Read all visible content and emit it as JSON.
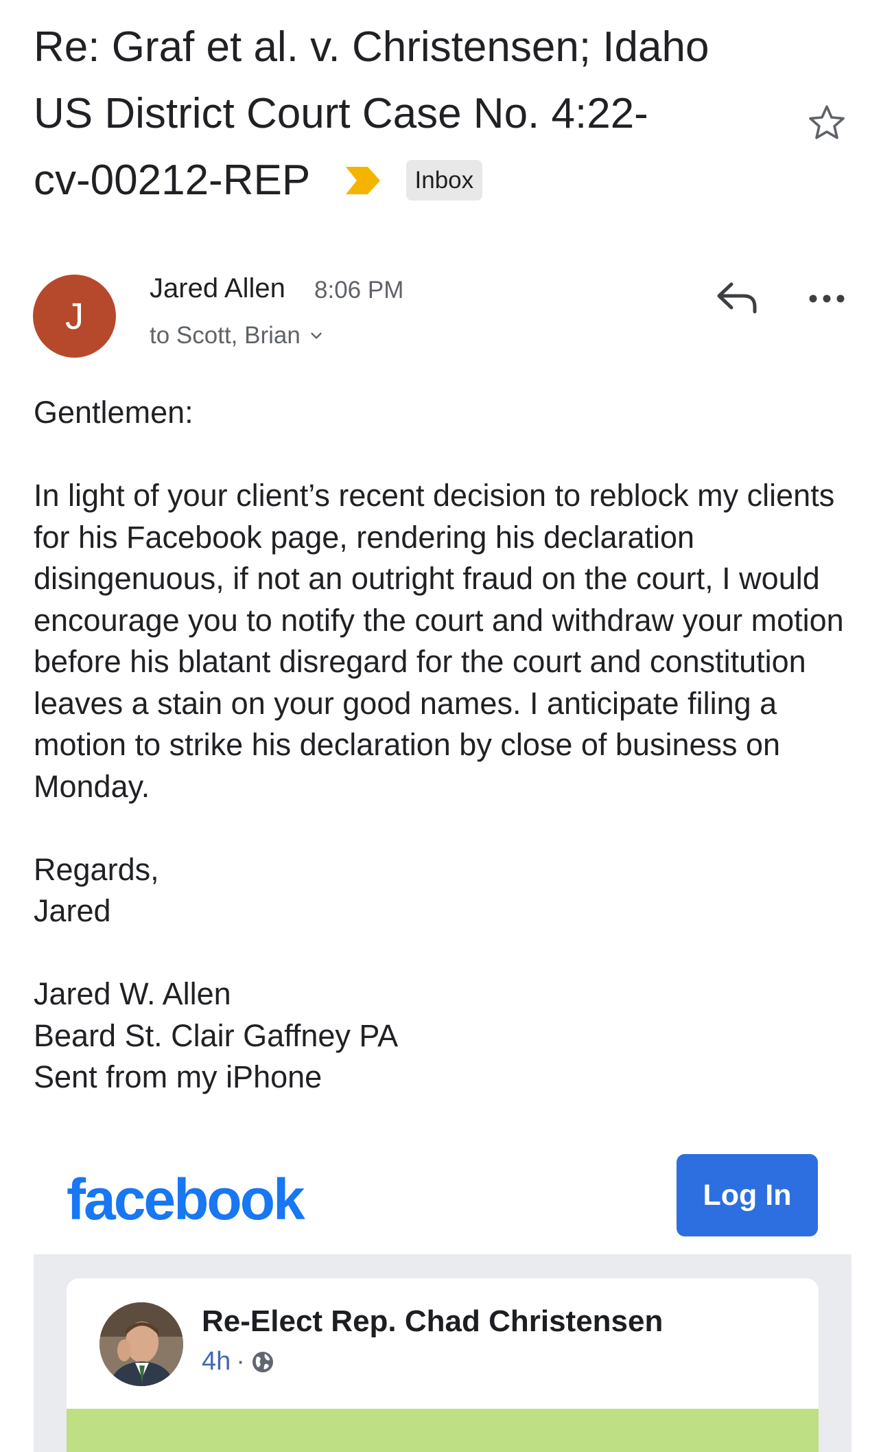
{
  "subject": {
    "text": "Re: Graf et al. v. Christensen; Idaho US District Court Case No. 4:22-cv-00212-REP",
    "line1": "Re: Graf et al. v. Christensen; Idaho",
    "line2": "US District Court Case No. 4:22-",
    "line3": "cv-00212-REP",
    "label_chip": "Inbox",
    "importance_icon": "importance-marker-icon",
    "star_icon": "star-icon"
  },
  "message": {
    "sender_initial": "J",
    "sender_name": "Jared Allen",
    "time": "8:06 PM",
    "recipients": "to Scott, Brian",
    "avatar_color": "#b6492b",
    "reply_icon": "reply-icon",
    "more_icon": "more-icon",
    "body": "Gentlemen:\n\nIn light of your client’s recent decision to reblock my clients for his Facebook page, rendering his declaration disingenuous, if not an outright fraud on the court, I would encourage you to notify the court and withdraw your motion before his blatant disregard for the court and constitution leaves a stain on your good names. I anticipate filing a motion to strike his declaration by close of business on Monday.\n\nRegards,\nJared\n\nJared W. Allen\nBeard St. Clair Gaffney PA\nSent from my iPhone"
  },
  "facebook_preview": {
    "logo": "facebook",
    "login_label": "Log In",
    "page_name": "Re-Elect Rep. Chad Christensen",
    "post_time": "4h",
    "separator": "·",
    "audience_icon": "globe-icon",
    "brand_color": "#1877f2",
    "button_color": "#2d6fe0"
  }
}
